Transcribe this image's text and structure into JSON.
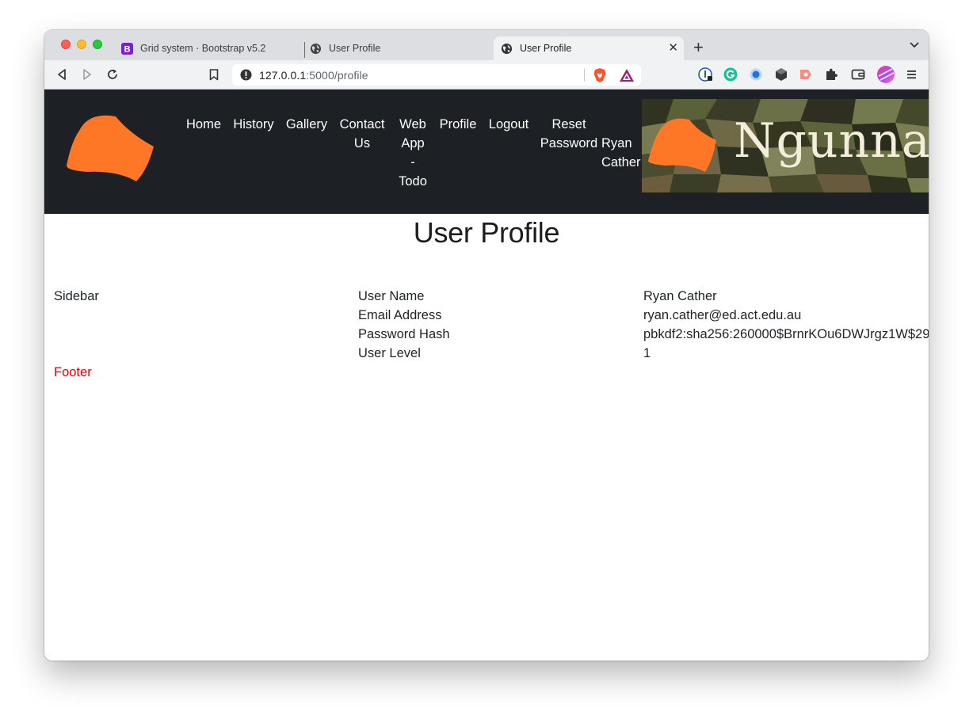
{
  "browser": {
    "tabs": [
      {
        "label": "Grid system · Bootstrap v5.2"
      },
      {
        "label": "User Profile"
      },
      {
        "label": "User Profile"
      }
    ],
    "url_host": "127.0.0.1",
    "url_rest": ":5000/profile"
  },
  "nav": {
    "items": [
      {
        "label": "Home"
      },
      {
        "label": "History"
      },
      {
        "label": "Gallery"
      },
      {
        "label": "Contact Us",
        "lines": [
          "Contact",
          "Us"
        ]
      },
      {
        "label": "Web App - Todo",
        "lines": [
          "Web",
          "App",
          "-",
          "Todo"
        ]
      },
      {
        "label": "Profile"
      },
      {
        "label": "Logout"
      },
      {
        "label": "Reset Password",
        "lines": [
          "Reset",
          "Password"
        ]
      }
    ],
    "user": {
      "lines": [
        "Ryan",
        "Cather"
      ]
    },
    "banner_text": "Ngunnawal"
  },
  "page": {
    "title": "User Profile",
    "sidebar": "Sidebar",
    "footer": "Footer",
    "profile": {
      "labels": [
        "User Name",
        "Email Address",
        "Password Hash",
        "User Level"
      ],
      "values": [
        "Ryan Cather",
        "ryan.cather@ed.act.edu.au",
        "pbkdf2:sha256:260000$BrnrKOu6DWJrgz1W$29",
        "1"
      ]
    }
  },
  "colors": {
    "nav_bg": "#1d2024",
    "logo_orange": "#fd7726",
    "footer_red": "#e8000b"
  }
}
